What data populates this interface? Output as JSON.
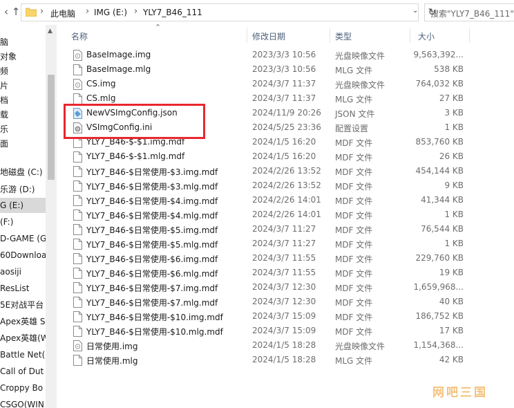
{
  "address": {
    "segments": [
      "此电脑",
      "IMG (E:)",
      "YLY7_B46_111"
    ],
    "search_placeholder": "搜索\"YLY7_B46_111\""
  },
  "navigation": {
    "items": [
      {
        "label": "脑",
        "selected": false
      },
      {
        "label": "对象",
        "selected": false
      },
      {
        "label": "频",
        "selected": false
      },
      {
        "label": "片",
        "selected": false
      },
      {
        "label": "档",
        "selected": false
      },
      {
        "label": "载",
        "selected": false
      },
      {
        "label": "乐",
        "selected": false
      },
      {
        "label": "面",
        "selected": false
      },
      {
        "label": "地磁盘 (C:)",
        "selected": false
      },
      {
        "label": "乐游 (D:)",
        "selected": false
      },
      {
        "label": "G (E:)",
        "selected": true
      },
      {
        "label": "(F:)",
        "selected": false
      },
      {
        "label": "D-GAME (G:)",
        "selected": false
      },
      {
        "label": "60Download",
        "selected": false
      },
      {
        "label": "aosiji",
        "selected": false
      },
      {
        "label": "ResList",
        "selected": false
      },
      {
        "label": "5E对战平台",
        "selected": false
      },
      {
        "label": "Apex英雄 S",
        "selected": false
      },
      {
        "label": "Apex英雄(W",
        "selected": false
      },
      {
        "label": "Battle Net(",
        "selected": false
      },
      {
        "label": "Call of Dut",
        "selected": false
      },
      {
        "label": "Croppy Bo",
        "selected": false
      },
      {
        "label": "CSGO(WIN",
        "selected": false
      }
    ]
  },
  "columns": {
    "name": "名称",
    "date": "修改日期",
    "type": "类型",
    "size": "大小"
  },
  "files": [
    {
      "name": "BaseImage.img",
      "date": "2023/3/3 10:56",
      "type": "光盘映像文件",
      "size": "9,563,392...",
      "icon": "disc-image-icon"
    },
    {
      "name": "BaseImage.mlg",
      "date": "2023/3/3 10:56",
      "type": "MLG 文件",
      "size": "538 KB",
      "icon": "file-icon"
    },
    {
      "name": "CS.img",
      "date": "2024/3/7 11:37",
      "type": "光盘映像文件",
      "size": "764,032 KB",
      "icon": "disc-image-icon"
    },
    {
      "name": "CS.mlg",
      "date": "2024/3/7 11:37",
      "type": "MLG 文件",
      "size": "27 KB",
      "icon": "file-icon"
    },
    {
      "name": "NewVSImgConfig.json",
      "date": "2024/11/9 20:26",
      "type": "JSON 文件",
      "size": "3 KB",
      "icon": "json-file-icon"
    },
    {
      "name": "VSImgConfig.ini",
      "date": "2024/5/25 23:36",
      "type": "配置设置",
      "size": "1 KB",
      "icon": "config-file-icon"
    },
    {
      "name": "YLY7_B46-$-$1.img.mdf",
      "date": "2024/1/5 16:20",
      "type": "MDF 文件",
      "size": "853,760 KB",
      "icon": "file-icon"
    },
    {
      "name": "YLY7_B46-$-$1.mlg.mdf",
      "date": "2024/1/5 16:20",
      "type": "MDF 文件",
      "size": "26 KB",
      "icon": "file-icon"
    },
    {
      "name": "YLY7_B46-$日常使用-$3.img.mdf",
      "date": "2024/2/26 13:52",
      "type": "MDF 文件",
      "size": "454,144 KB",
      "icon": "file-icon"
    },
    {
      "name": "YLY7_B46-$日常使用-$3.mlg.mdf",
      "date": "2024/2/26 13:52",
      "type": "MDF 文件",
      "size": "9 KB",
      "icon": "file-icon"
    },
    {
      "name": "YLY7_B46-$日常使用-$4.img.mdf",
      "date": "2024/2/26 14:01",
      "type": "MDF 文件",
      "size": "41,344 KB",
      "icon": "file-icon"
    },
    {
      "name": "YLY7_B46-$日常使用-$4.mlg.mdf",
      "date": "2024/2/26 14:01",
      "type": "MDF 文件",
      "size": "1 KB",
      "icon": "file-icon"
    },
    {
      "name": "YLY7_B46-$日常使用-$5.img.mdf",
      "date": "2024/3/7 11:27",
      "type": "MDF 文件",
      "size": "76,544 KB",
      "icon": "file-icon"
    },
    {
      "name": "YLY7_B46-$日常使用-$5.mlg.mdf",
      "date": "2024/3/7 11:27",
      "type": "MDF 文件",
      "size": "1 KB",
      "icon": "file-icon"
    },
    {
      "name": "YLY7_B46-$日常使用-$6.img.mdf",
      "date": "2024/3/7 11:55",
      "type": "MDF 文件",
      "size": "229,760 KB",
      "icon": "file-icon"
    },
    {
      "name": "YLY7_B46-$日常使用-$6.mlg.mdf",
      "date": "2024/3/7 11:55",
      "type": "MDF 文件",
      "size": "19 KB",
      "icon": "file-icon"
    },
    {
      "name": "YLY7_B46-$日常使用-$7.img.mdf",
      "date": "2024/3/7 12:30",
      "type": "MDF 文件",
      "size": "1,659,968...",
      "icon": "file-icon"
    },
    {
      "name": "YLY7_B46-$日常使用-$7.mlg.mdf",
      "date": "2024/3/7 12:30",
      "type": "MDF 文件",
      "size": "40 KB",
      "icon": "file-icon"
    },
    {
      "name": "YLY7_B46-$日常使用-$10.img.mdf",
      "date": "2024/3/7 15:09",
      "type": "MDF 文件",
      "size": "186,752 KB",
      "icon": "file-icon"
    },
    {
      "name": "YLY7_B46-$日常使用-$10.mlg.mdf",
      "date": "2024/3/7 15:09",
      "type": "MDF 文件",
      "size": "17 KB",
      "icon": "file-icon"
    },
    {
      "name": "日常使用.img",
      "date": "2024/1/5 18:28",
      "type": "光盘映像文件",
      "size": "1,154,368...",
      "icon": "disc-image-icon"
    },
    {
      "name": "日常使用.mlg",
      "date": "2024/1/5 18:28",
      "type": "MLG 文件",
      "size": "42 KB",
      "icon": "file-icon"
    }
  ],
  "highlight_color": "#e8272e",
  "watermark": "网吧三国"
}
